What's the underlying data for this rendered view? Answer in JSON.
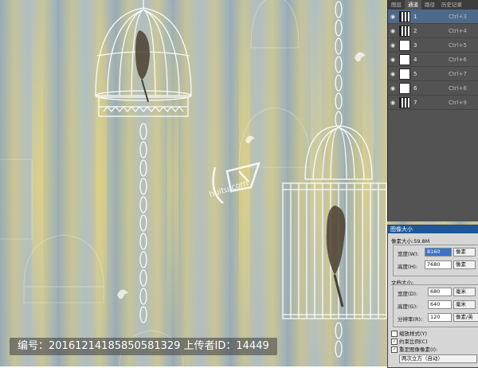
{
  "caption": "编号：20161214185850581329 上传者ID：14449",
  "watermark": {
    "text": "huitu.com"
  },
  "layers_panel": {
    "tabs": [
      "图层",
      "通道",
      "路径",
      "历史记录"
    ],
    "active_tab": 1,
    "rows": [
      {
        "name": "1",
        "shortcut": "Ctrl+3",
        "selected": true
      },
      {
        "name": "2",
        "shortcut": "Ctrl+4",
        "selected": false
      },
      {
        "name": "3",
        "shortcut": "Ctrl+5",
        "selected": false
      },
      {
        "name": "4",
        "shortcut": "Ctrl+6",
        "selected": false
      },
      {
        "name": "5",
        "shortcut": "Ctrl+7",
        "selected": false
      },
      {
        "name": "6",
        "shortcut": "Ctrl+8",
        "selected": false
      },
      {
        "name": "7",
        "shortcut": "Ctrl+9",
        "selected": false
      }
    ]
  },
  "dialog": {
    "title": "图像大小",
    "pixel_size": "像素大小:59.8M",
    "width_label": "宽度(W):",
    "width_value": "8160",
    "height_label": "高度(H):",
    "height_value": "7680",
    "pixel_unit": "像素",
    "doc_size": "文档大小:",
    "doc_width_label": "宽度(D):",
    "doc_width": "680",
    "doc_height_label": "高度(G):",
    "doc_height": "640",
    "unit_mm": "毫米",
    "resolution_label": "分辨率(R):",
    "resolution": "120",
    "resolution_unit": "像素/英寸",
    "scale_styles": "缩放样式(Y)",
    "constrain": "约束比例(C)",
    "resample": "重定图像像素(I):",
    "method": "两次立方（自动）"
  },
  "colors": {
    "selected_row": "#4d6a8a",
    "panel_bg": "#535353",
    "dialog_title": "#1e5799"
  }
}
